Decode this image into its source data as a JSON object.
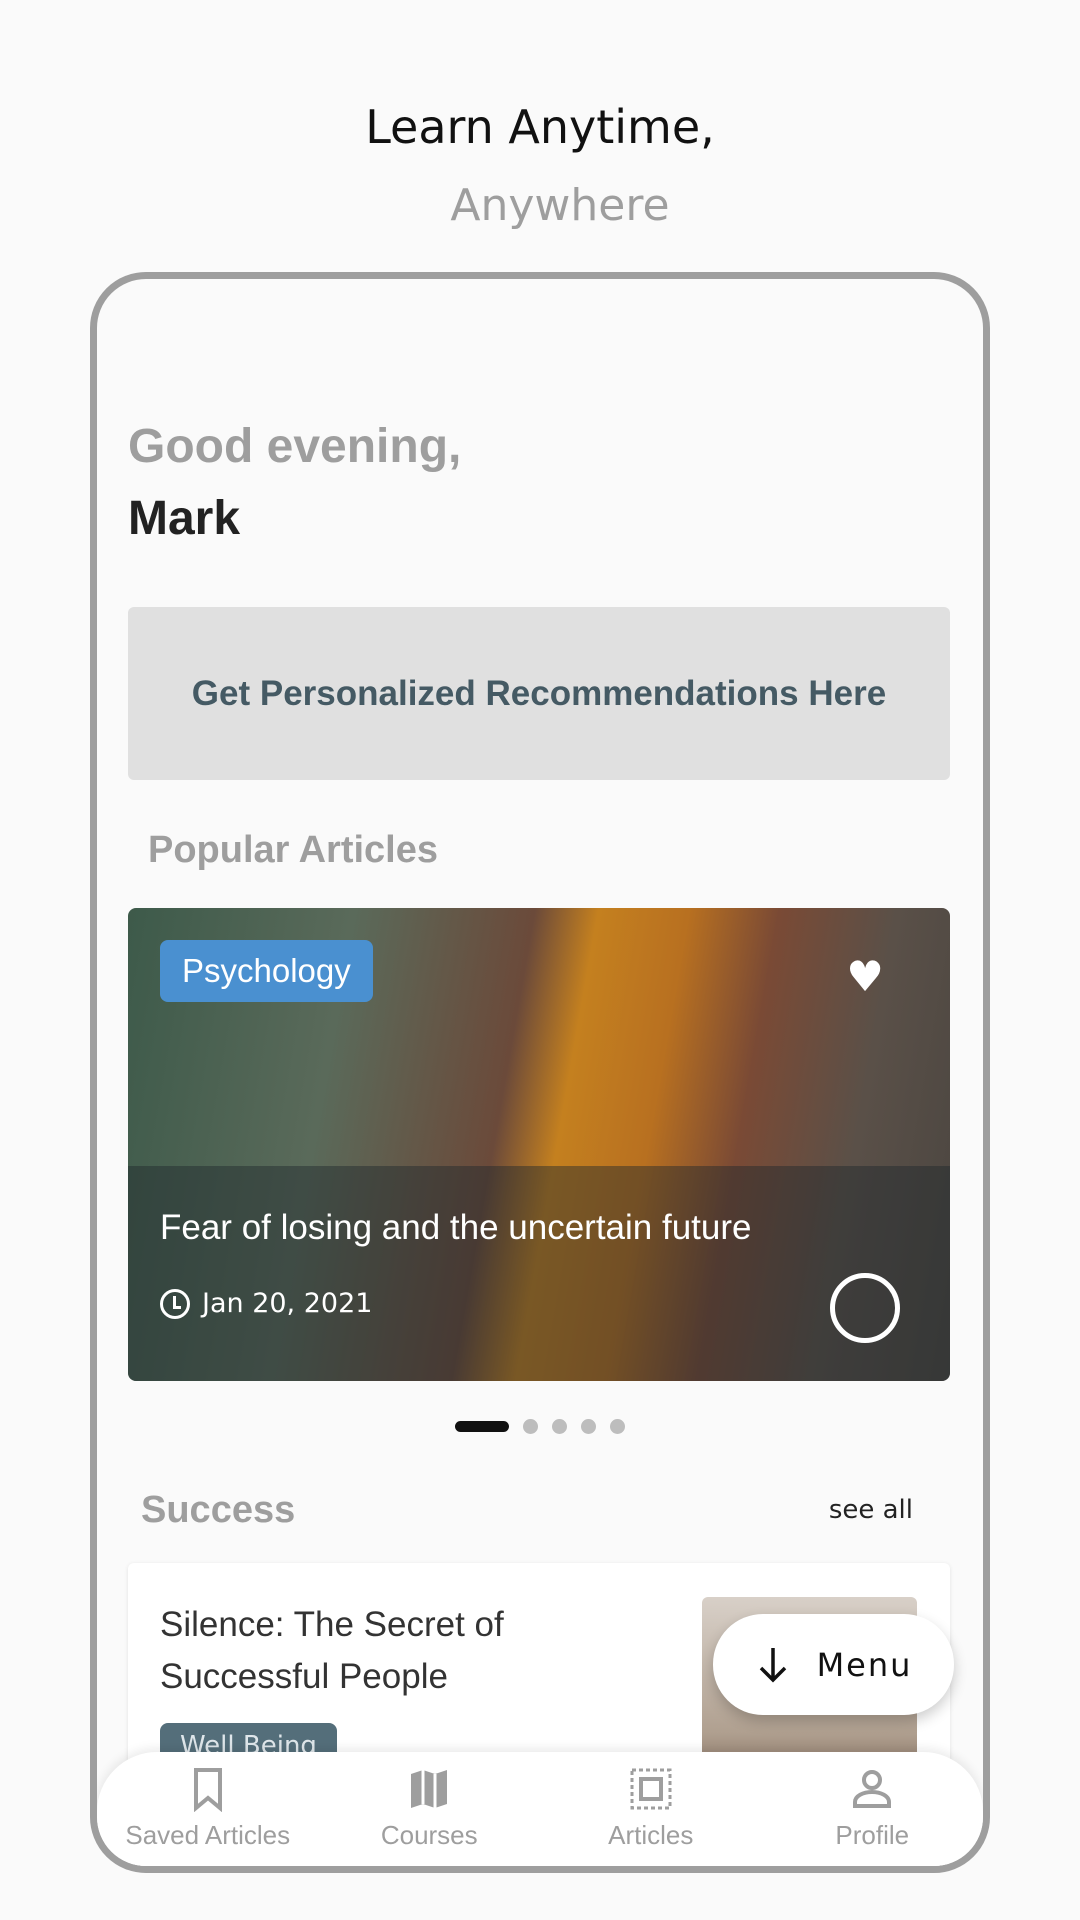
{
  "header": {
    "line1": "Learn Anytime,",
    "line2": "Anywhere"
  },
  "greeting": {
    "salutation": "Good evening,",
    "name": "Mark"
  },
  "banner": {
    "label": "Get Personalized Recommendations Here"
  },
  "popular": {
    "title": "Popular Articles",
    "card": {
      "category": "Psychology",
      "title": "Fear of losing and the uncertain future",
      "date": "Jan 20, 2021",
      "favorited": true
    },
    "pagination": {
      "total": 5,
      "active": 1
    }
  },
  "success": {
    "title": "Success",
    "see_all": "see all",
    "card": {
      "title": "Silence: The Secret of Successful People",
      "tag": "Well Being"
    }
  },
  "menu_button": {
    "label": "Menu",
    "icon": "arrow-down-icon"
  },
  "nav": {
    "items": [
      {
        "label": "Saved Articles",
        "icon": "bookmark-icon"
      },
      {
        "label": "Courses",
        "icon": "map-icon"
      },
      {
        "label": "Articles",
        "icon": "article-frame-icon"
      },
      {
        "label": "Profile",
        "icon": "person-icon"
      }
    ]
  },
  "colors": {
    "accent_tag": "#4a90d0",
    "banner_text": "#455a64",
    "muted": "#9e9e9e"
  }
}
